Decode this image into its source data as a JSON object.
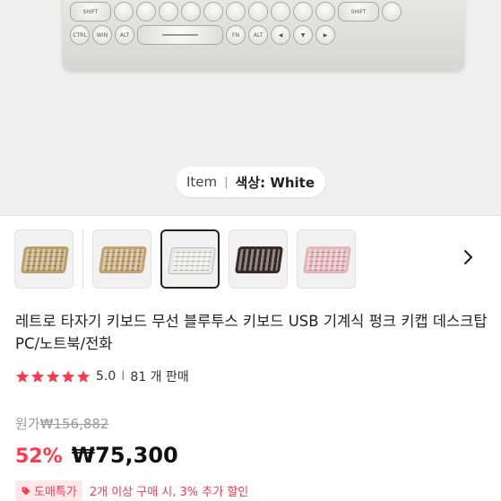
{
  "hero": {
    "keyboard_keys": {
      "row1": [
        "SHIFT",
        "",
        "",
        "",
        "",
        "",
        "",
        "",
        "",
        "",
        "",
        "SHIFT",
        ""
      ],
      "row2": [
        "CTRL",
        "WIN",
        "ALT",
        "",
        "FN",
        "ALT",
        "",
        "",
        ""
      ]
    },
    "variant_pill": {
      "label": "Item",
      "separator": "|",
      "option_key": "색상: White"
    }
  },
  "thumbnails": [
    {
      "name": "thumb-1",
      "color": "#b9a06a"
    },
    {
      "name": "thumb-2",
      "color": "#c2a472"
    },
    {
      "name": "thumb-3",
      "color": "#e9e9e4"
    },
    {
      "name": "thumb-4",
      "color": "#3a2a26"
    },
    {
      "name": "thumb-5",
      "color": "#e4b5b9"
    }
  ],
  "product": {
    "title": "레트로 타자기 키보드 무선 블루투스 키보드 USB 기계식 펑크 키캡 데스크탑 PC/노트북/전화",
    "rating_value": "5.0",
    "rating_separator": "I",
    "sales_count": "81 개 판매",
    "original_label": "원가",
    "original_price": "₩156,882",
    "discount": "52%",
    "price": "₩75,300",
    "promo_badge": "도매특가",
    "promo_text": "2개 이상 구매 시, 3% 추가 할인"
  },
  "colors": {
    "accent": "#ff3a4f",
    "star": "#ff3a4f"
  }
}
